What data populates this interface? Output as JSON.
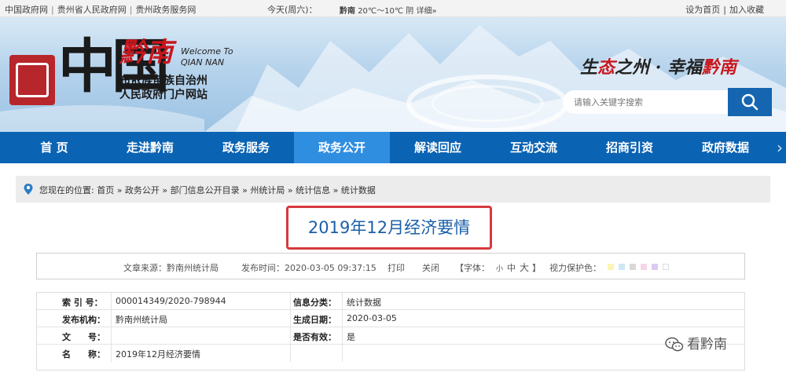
{
  "topbar": {
    "links": [
      "中国政府网",
      "贵州省人民政府网",
      "贵州政务服务网"
    ],
    "date": "今天(周六)：",
    "weather_city": "黔南",
    "weather_temp": "20℃～10℃",
    "weather_state": "阴",
    "weather_detail": "详细»",
    "set_home": "设为首页",
    "favorite": "加入收藏"
  },
  "banner": {
    "logo_main": "中国",
    "logo_qiannan": "黔南",
    "welcome_1": "Welcome To",
    "welcome_2": "QIAN NAN",
    "subtitle_1": "布依族苗族自治州",
    "subtitle_2": "人民政府门户网站",
    "slogan_1": "生",
    "slogan_2": "态",
    "slogan_3": "之州 · 幸福",
    "slogan_4": "黔南",
    "search_placeholder": "请输入关键字搜索"
  },
  "nav": {
    "items": [
      "首 页",
      "走进黔南",
      "政务服务",
      "政务公开",
      "解读回应",
      "互动交流",
      "招商引资",
      "政府数据"
    ],
    "active_index": 3
  },
  "breadcrumb": "您现在的位置: 首页 » 政务公开 » 部门信息公开目录 » 州统计局 » 统计信息 » 统计数据",
  "article": {
    "title": "2019年12月经济要情"
  },
  "meta": {
    "source": "文章来源：黔南州统计局",
    "publish_time": "发布时间：2020-03-05 09:37:15",
    "print": "打印",
    "close": "关闭",
    "font_label": "【字体：",
    "font_small": "小",
    "font_medium": "中",
    "font_large": "大",
    "font_end": "】",
    "eye_label": "视力保护色：",
    "swatches": [
      "#fdf4b5",
      "#cde8f5",
      "#d8d8d8",
      "#f5d5e6",
      "#dccbf0",
      "#ffffff"
    ]
  },
  "info": {
    "index_label": "索 引 号：",
    "index_value": "000014349/2020-798944",
    "category_label": "信息分类：",
    "category_value": "统计数据",
    "org_label": "发布机构：",
    "org_value": "黔南州统计局",
    "date_label": "生成日期：",
    "date_value": "2020-03-05",
    "doc_label": "文　　号：",
    "doc_value": "",
    "valid_label": "是否有效：",
    "valid_value": "是",
    "name_label": "名　　称：",
    "name_value": "2019年12月经济要情"
  },
  "watermark": "看黔南",
  "colors": {
    "nav": "#0b63b3",
    "nav_active": "#2f8ee0",
    "title": "#1b5fa8",
    "highlight": "#d63a3e",
    "brand_red": "#c8161d"
  }
}
